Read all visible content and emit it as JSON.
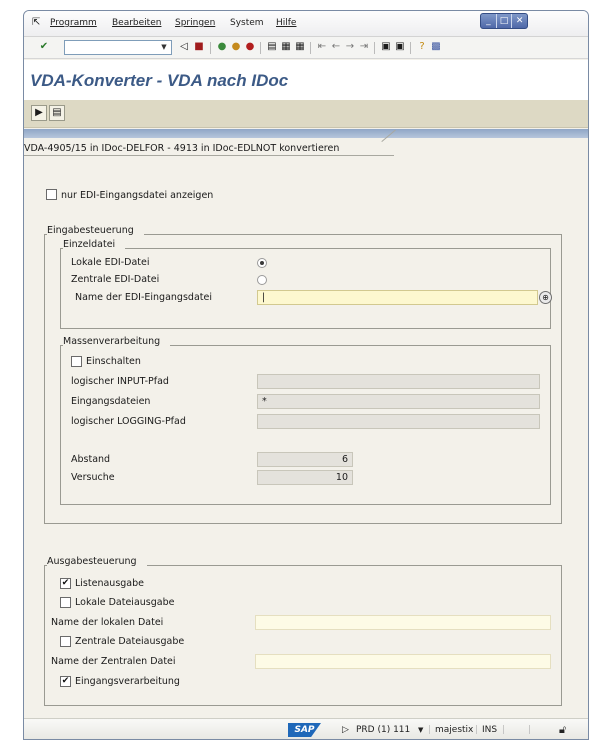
{
  "menu": {
    "items": [
      "Programm",
      "Bearbeiten",
      "Springen",
      "System",
      "Hilfe"
    ]
  },
  "window_controls": {
    "minimize": "_",
    "maximize": "□",
    "close": "✕"
  },
  "toolbar": {
    "command_field_value": "",
    "icons": [
      "check-icon",
      "back-icon",
      "save-icon",
      "back-nav-icon",
      "exit-icon",
      "cancel-icon",
      "print-icon",
      "find-icon",
      "find-next-icon",
      "first-page-icon",
      "prev-page-icon",
      "next-page-icon",
      "last-page-icon",
      "new-session-icon",
      "shortcut-icon",
      "help-icon",
      "layout-icon"
    ]
  },
  "page": {
    "title": "VDA-Konverter - VDA nach IDoc"
  },
  "app_toolbar": {
    "icons": [
      "execute-icon",
      "variant-icon"
    ]
  },
  "tab": {
    "label": "VDA-4905/15 in IDoc-DELFOR - 4913 in IDoc-EDLNOT konvertieren"
  },
  "option_show_only": {
    "label": "nur EDI-Eingangsdatei anzeigen",
    "checked": false
  },
  "eingabe": {
    "title": "Eingabesteuerung",
    "einzeldatei": {
      "title": "Einzeldatei",
      "lokal_label": "Lokale EDI-Datei",
      "zentral_label": "Zentrale EDI-Datei",
      "name_label": "Name der EDI-Eingangsdatei",
      "name_value": "|"
    },
    "masse": {
      "title": "Massenverarbeitung",
      "einschalten_label": "Einschalten",
      "input_pfad_label": "logischer INPUT-Pfad",
      "input_pfad_value": "",
      "eingangsdateien_label": "Eingangsdateien",
      "eingangsdateien_value": "*",
      "logging_pfad_label": "logischer LOGGING-Pfad",
      "logging_pfad_value": "",
      "abstand_label": "Abstand",
      "abstand_value": "6",
      "versuche_label": "Versuche",
      "versuche_value": "10"
    }
  },
  "ausgabe": {
    "title": "Ausgabesteuerung",
    "listenausgabe_label": "Listenausgabe",
    "lokale_dateiausgabe_label": "Lokale Dateiausgabe",
    "name_lokal_label": "Name der lokalen Datei",
    "name_lokal_value": "",
    "zentrale_dateiausgabe_label": "Zentrale Dateiausgabe",
    "name_zentral_label": "Name der Zentralen Datei",
    "name_zentral_value": "",
    "eingangsverarbeitung_label": "Eingangsverarbeitung"
  },
  "status": {
    "sap_logo": "SAP",
    "system": "PRD (1) 111",
    "server": "majestix",
    "mode": "INS"
  }
}
